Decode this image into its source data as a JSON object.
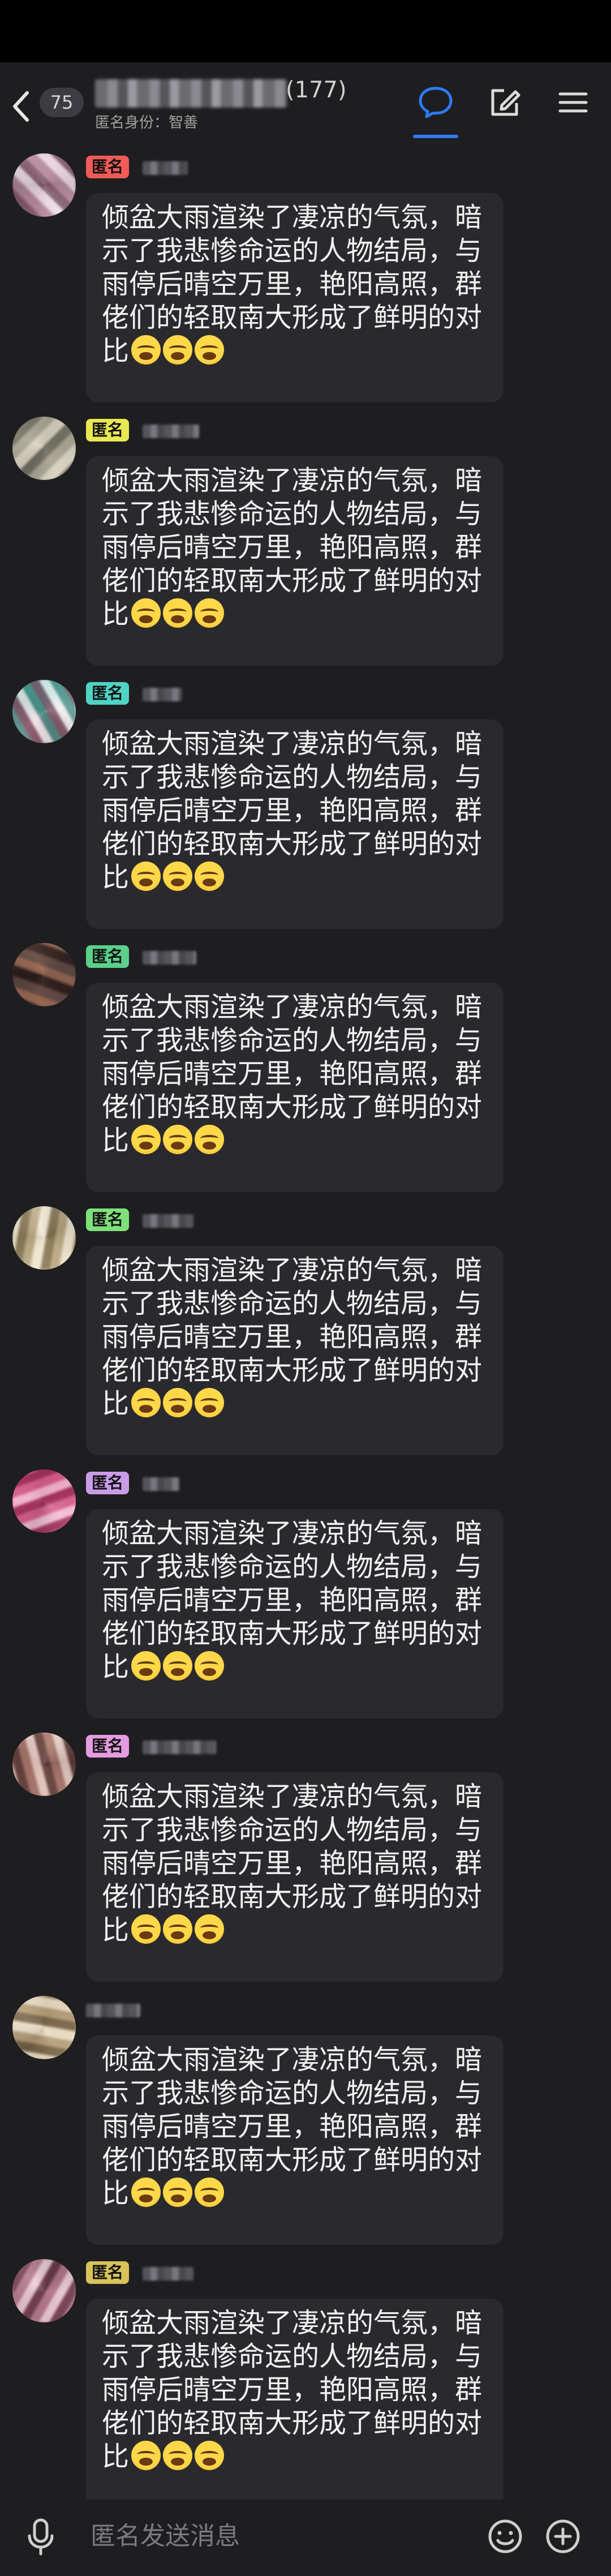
{
  "header": {
    "unread_count": "75",
    "member_count": "(177)",
    "anonymous_identity": "匿名身份：智善"
  },
  "messages": [
    {
      "tag": "匿名",
      "tag_color": "#f05b57",
      "text": "倾盆大雨渲染了凄凉的气氛，暗示了我悲惨命运的人物结局，与雨停后晴空万里，艳阳高照，群佬们的轻取南大形成了鲜明的对比"
    },
    {
      "tag": "匿名",
      "tag_color": "#e8e854",
      "text": "倾盆大雨渲染了凄凉的气氛，暗示了我悲惨命运的人物结局，与雨停后晴空万里，艳阳高照，群佬们的轻取南大形成了鲜明的对比"
    },
    {
      "tag": "匿名",
      "tag_color": "#4fd3c4",
      "text": "倾盆大雨渲染了凄凉的气氛，暗示了我悲惨命运的人物结局，与雨停后晴空万里，艳阳高照，群佬们的轻取南大形成了鲜明的对比"
    },
    {
      "tag": "匿名",
      "tag_color": "#5ad08a",
      "text": "倾盆大雨渲染了凄凉的气氛，暗示了我悲惨命运的人物结局，与雨停后晴空万里，艳阳高照，群佬们的轻取南大形成了鲜明的对比"
    },
    {
      "tag": "匿名",
      "tag_color": "#7fe07a",
      "text": "倾盆大雨渲染了凄凉的气氛，暗示了我悲惨命运的人物结局，与雨停后晴空万里，艳阳高照，群佬们的轻取南大形成了鲜明的对比"
    },
    {
      "tag": "匿名",
      "tag_color": "#c99ce8",
      "text": "倾盆大雨渲染了凄凉的气氛，暗示了我悲惨命运的人物结局，与雨停后晴空万里，艳阳高照，群佬们的轻取南大形成了鲜明的对比"
    },
    {
      "tag": "匿名",
      "tag_color": "#e49be0",
      "text": "倾盆大雨渲染了凄凉的气氛，暗示了我悲惨命运的人物结局，与雨停后晴空万里，艳阳高照，群佬们的轻取南大形成了鲜明的对比"
    },
    {
      "tag": "",
      "tag_color": "",
      "text": "倾盆大雨渲染了凄凉的气氛，暗示了我悲惨命运的人物结局，与雨停后晴空万里，艳阳高照，群佬们的轻取南大形成了鲜明的对比"
    },
    {
      "tag": "匿名",
      "tag_color": "#d8c25a",
      "text": "倾盆大雨渲染了凄凉的气氛，暗示了我悲惨命运的人物结局，与雨停后晴空万里，艳阳高照，群佬们的轻取南大形成了鲜明的对比"
    }
  ],
  "input": {
    "placeholder": "匿名发送消息"
  },
  "icons": {
    "back": "chevron-left-icon",
    "chat": "chat-bubble-icon",
    "edit": "edit-icon",
    "menu": "menu-icon",
    "voice": "microphone-icon",
    "emoji": "emoji-icon",
    "plus": "plus-icon",
    "message_emoji": "crying-face-emoji"
  },
  "colors": {
    "accent": "#2f7bf5",
    "background": "#1e1e21",
    "bubble": "#2a2a2e"
  }
}
